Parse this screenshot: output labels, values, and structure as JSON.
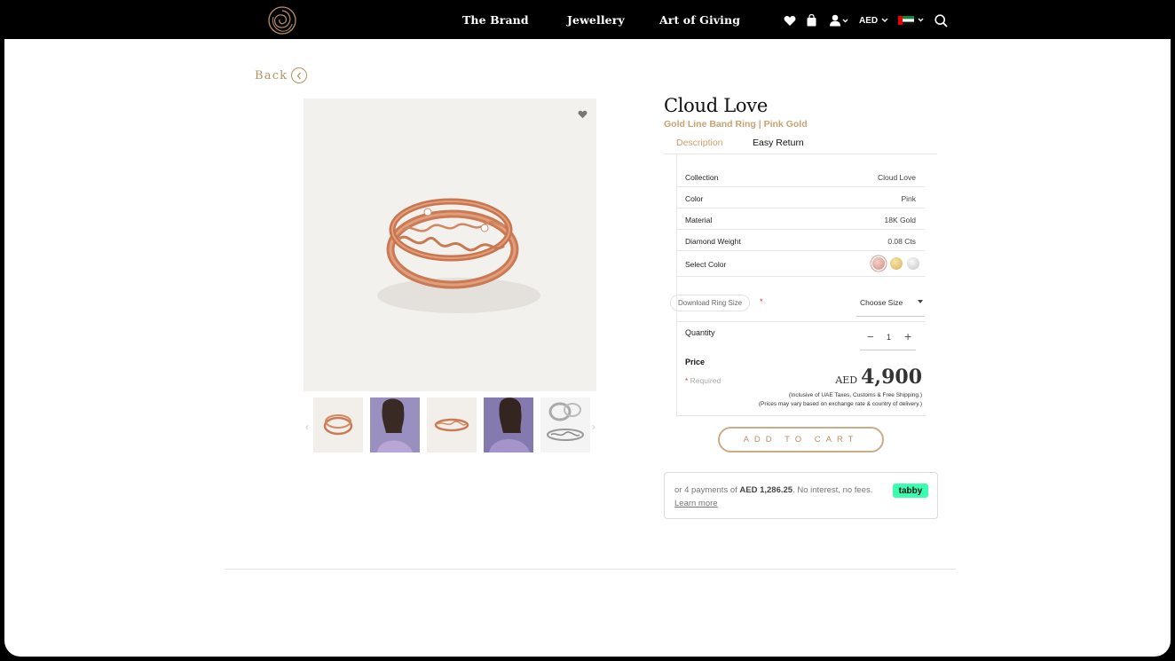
{
  "nav": {
    "links": [
      "The Brand",
      "Jewellery",
      "Art of Giving"
    ],
    "currency": "AED",
    "icons": [
      "heart-icon",
      "bag-icon",
      "user-icon",
      "flag-uae-icon",
      "search-icon"
    ]
  },
  "back_label": "Back",
  "product": {
    "title": "Cloud Love",
    "subtitle": "Gold Line Band Ring | Pink Gold",
    "tabs": [
      "Description",
      "Easy Return"
    ],
    "specs": [
      {
        "key": "Collection",
        "value": "Cloud Love"
      },
      {
        "key": "Color",
        "value": "Pink"
      },
      {
        "key": "Material",
        "value": "18K Gold"
      },
      {
        "key": "Diamond Weight",
        "value": "0.08 Cts"
      }
    ],
    "select_color_label": "Select Color",
    "swatches": [
      {
        "name": "pink-gold",
        "color": "#d9a39a"
      },
      {
        "name": "yellow-gold",
        "color": "#e5c77e"
      },
      {
        "name": "white-gold",
        "color": "#d8d8d8"
      }
    ],
    "download_ring_size": "Download Ring Size",
    "required_star": "*",
    "size_select": "Choose Size",
    "quantity_label": "Quantity",
    "quantity_value": "1",
    "price_label": "Price",
    "required_label": "Required",
    "currency": "AED",
    "price": "4,900",
    "price_note_1": "(Inclusive of UAE Taxes, Customs & Free Shipping.)",
    "price_note_2": "(Prices may vary based on exchange rate & country of delivery.)",
    "add_to_cart": "ADD TO CART"
  },
  "tabby": {
    "text_before": "or 4 payments of",
    "amount": "AED 1,286.25",
    "text_after": ". No interest, no fees.",
    "learn_more": "Learn more",
    "logo": "tabby"
  },
  "colors": {
    "accent": "#b79166",
    "header": "#000000",
    "tabby": "#3bffaf"
  }
}
